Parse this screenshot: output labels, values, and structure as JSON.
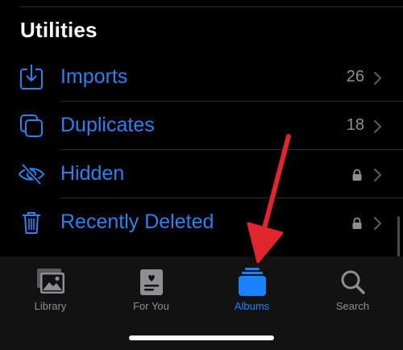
{
  "section": {
    "title": "Utilities"
  },
  "utilities": [
    {
      "label": "Imports",
      "count": "26",
      "icon": "import-icon",
      "locked": false
    },
    {
      "label": "Duplicates",
      "count": "18",
      "icon": "duplicates-icon",
      "locked": false
    },
    {
      "label": "Hidden",
      "count": "",
      "icon": "hidden-eye-icon",
      "locked": true
    },
    {
      "label": "Recently Deleted",
      "count": "",
      "icon": "trash-icon",
      "locked": true
    }
  ],
  "tabs": [
    {
      "label": "Library",
      "icon": "library-icon",
      "active": false
    },
    {
      "label": "For You",
      "icon": "for-you-icon",
      "active": false
    },
    {
      "label": "Albums",
      "icon": "albums-icon",
      "active": true
    },
    {
      "label": "Search",
      "icon": "search-icon",
      "active": false
    }
  ],
  "colors": {
    "accent": "#2d7ff2",
    "tab_active": "#1a82ff",
    "secondary_text": "#8e8e93",
    "annotation_arrow": "#e0262c"
  }
}
